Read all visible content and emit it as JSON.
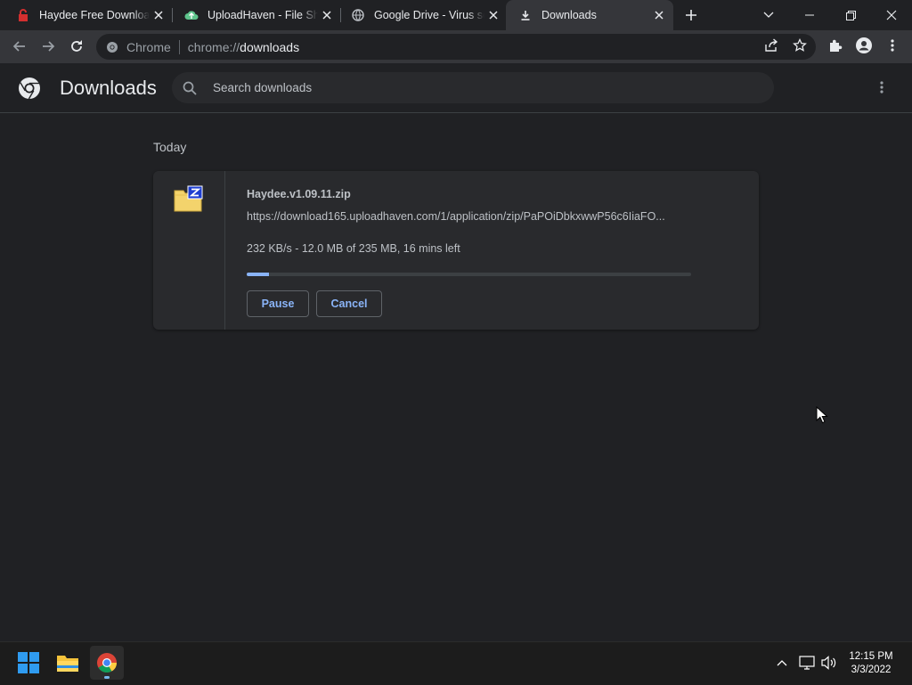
{
  "tabs": [
    {
      "title": "Haydee Free Download",
      "favicon": "haydee-red-icon"
    },
    {
      "title": "UploadHaven - File Sha",
      "favicon": "uploadhaven-cloud-icon"
    },
    {
      "title": "Google Drive - Virus sc",
      "favicon": "globe-icon"
    },
    {
      "title": "Downloads",
      "favicon": "download-icon"
    }
  ],
  "omnibox": {
    "chip": "Chrome",
    "scheme": "chrome://",
    "host": "downloads"
  },
  "header": {
    "title": "Downloads",
    "search_placeholder": "Search downloads"
  },
  "downloads": {
    "section_label": "Today",
    "item": {
      "filename": "Haydee.v1.09.11.zip",
      "url": "https://download165.uploadhaven.com/1/application/zip/PaPOiDbkxwwP56c6IiaFO...",
      "status": "232 KB/s - 12.0 MB of 235 MB, 16 mins left",
      "progress_fraction": 0.05,
      "pause_label": "Pause",
      "cancel_label": "Cancel"
    }
  },
  "taskbar": {
    "time": "12:15 PM",
    "date": "3/3/2022"
  },
  "colors": {
    "accent": "#8ab4f8",
    "background": "#202124",
    "toolbar": "#35363a",
    "card": "#292a2d"
  }
}
